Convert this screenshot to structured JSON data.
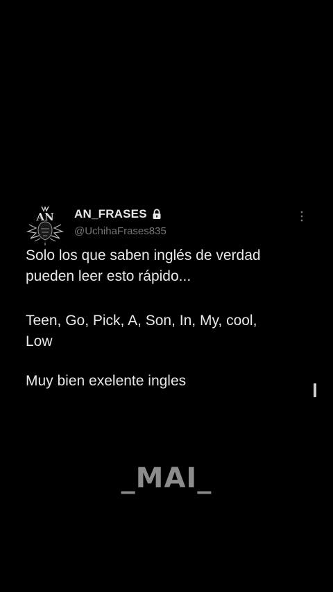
{
  "tweet": {
    "display_name": "AN_FRASES",
    "handle": "@UchihaFrases835",
    "avatar_monogram": "AN",
    "lock_icon": "lock-icon",
    "more_icon": "vertical-dots-icon",
    "paragraph_1": "Solo los que saben inglés de verdad\npueden leer esto rápido...",
    "paragraph_2": "Teen, Go, Pick, A, Son, In, My, cool,\nLow",
    "paragraph_3": "Muy bien exelente ingles"
  },
  "watermark": {
    "text": "_MAI_"
  },
  "colors": {
    "background": "#000000",
    "text": "#e7e9ea",
    "handle": "#71767b",
    "watermark": "#8c8c8c"
  }
}
